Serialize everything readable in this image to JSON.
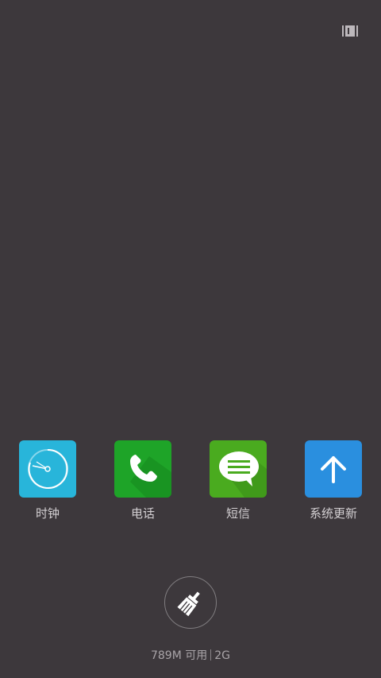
{
  "header": {
    "toggle_icon": "multi-window-toggle-icon"
  },
  "apps": [
    {
      "label": "时钟",
      "icon": "clock-icon",
      "color": "#2ab6db"
    },
    {
      "label": "电话",
      "icon": "phone-icon",
      "color": "#1fa82a"
    },
    {
      "label": "短信",
      "icon": "message-icon",
      "color": "#4aac20"
    },
    {
      "label": "系统更新",
      "icon": "upload-arrow-icon",
      "color": "#2a8fe0"
    }
  ],
  "memory": {
    "available": "789M 可用",
    "total": "2G"
  },
  "clean_button": {
    "icon": "broom-icon"
  }
}
